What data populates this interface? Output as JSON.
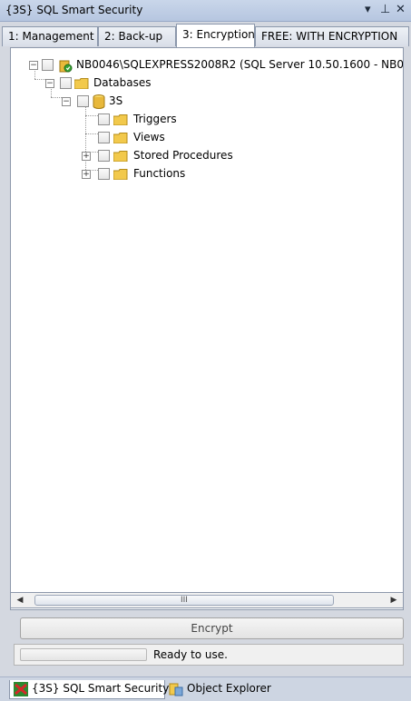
{
  "window": {
    "title": "{3S} SQL Smart Security",
    "pin_glyph": "▾ ⊥",
    "close_glyph": "✕"
  },
  "tabs": [
    {
      "label": "1: Management",
      "active": false
    },
    {
      "label": "2: Back-up",
      "active": false
    },
    {
      "label": "3: Encryption",
      "active": true
    },
    {
      "label": "FREE: WITH ENCRYPTION",
      "active": false
    }
  ],
  "tree": {
    "server": {
      "label": "NB0046\\SQLEXPRESS2008R2 (SQL Server 10.50.1600 - NB0",
      "icon": "server-icon",
      "expanded": true
    },
    "databases": {
      "label": "Databases",
      "icon": "folder-icon",
      "expanded": true
    },
    "database": {
      "label": "3S",
      "icon": "database-icon",
      "expanded": true
    },
    "items": [
      {
        "label": "Triggers",
        "icon": "folder-icon",
        "expandable": false
      },
      {
        "label": "Views",
        "icon": "folder-icon",
        "expandable": false
      },
      {
        "label": "Stored Procedures",
        "icon": "folder-icon",
        "expandable": true
      },
      {
        "label": "Functions",
        "icon": "folder-icon",
        "expandable": true
      }
    ]
  },
  "scrollbar": {
    "left_arrow": "◀",
    "right_arrow": "▶",
    "grip": "III"
  },
  "actions": {
    "encrypt_label": "Encrypt"
  },
  "status": {
    "text": "Ready to use.",
    "progress": 0
  },
  "bottom_tabs": [
    {
      "label": "{3S} SQL Smart Security",
      "icon": "smart-security-icon",
      "active": true
    },
    {
      "label": "Object Explorer",
      "icon": "object-explorer-icon",
      "active": false
    }
  ],
  "colors": {
    "accent": "#b6c6e0",
    "folder": "#f2c94c",
    "server_green": "#3aa335"
  }
}
